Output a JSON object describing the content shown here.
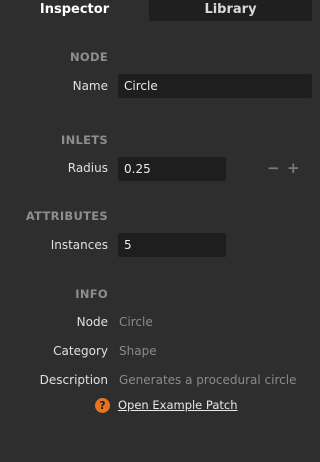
{
  "tabs": [
    {
      "label": "Inspector",
      "active": true
    },
    {
      "label": "Library",
      "active": false
    }
  ],
  "node": {
    "heading": "NODE",
    "name_label": "Name",
    "name_value": "Circle"
  },
  "inlets": {
    "heading": "INLETS",
    "radius_label": "Radius",
    "radius_value": "0.25",
    "decrement": "−",
    "increment": "+"
  },
  "attributes": {
    "heading": "ATTRIBUTES",
    "instances_label": "Instances",
    "instances_value": "5"
  },
  "info": {
    "heading": "INFO",
    "node_label": "Node",
    "node_value": "Circle",
    "category_label": "Category",
    "category_value": "Shape",
    "description_label": "Description",
    "description_value": "Generates a procedural circle",
    "help_glyph": "?",
    "example_link": "Open Example Patch"
  },
  "colors": {
    "panel_bg": "#2e2e2e",
    "tab_bar_bg": "#1f1f1f",
    "field_bg": "#1e1e1e",
    "help_accent": "#e8731c"
  },
  "icons": [
    "help-icon",
    "minus-icon",
    "plus-icon"
  ]
}
